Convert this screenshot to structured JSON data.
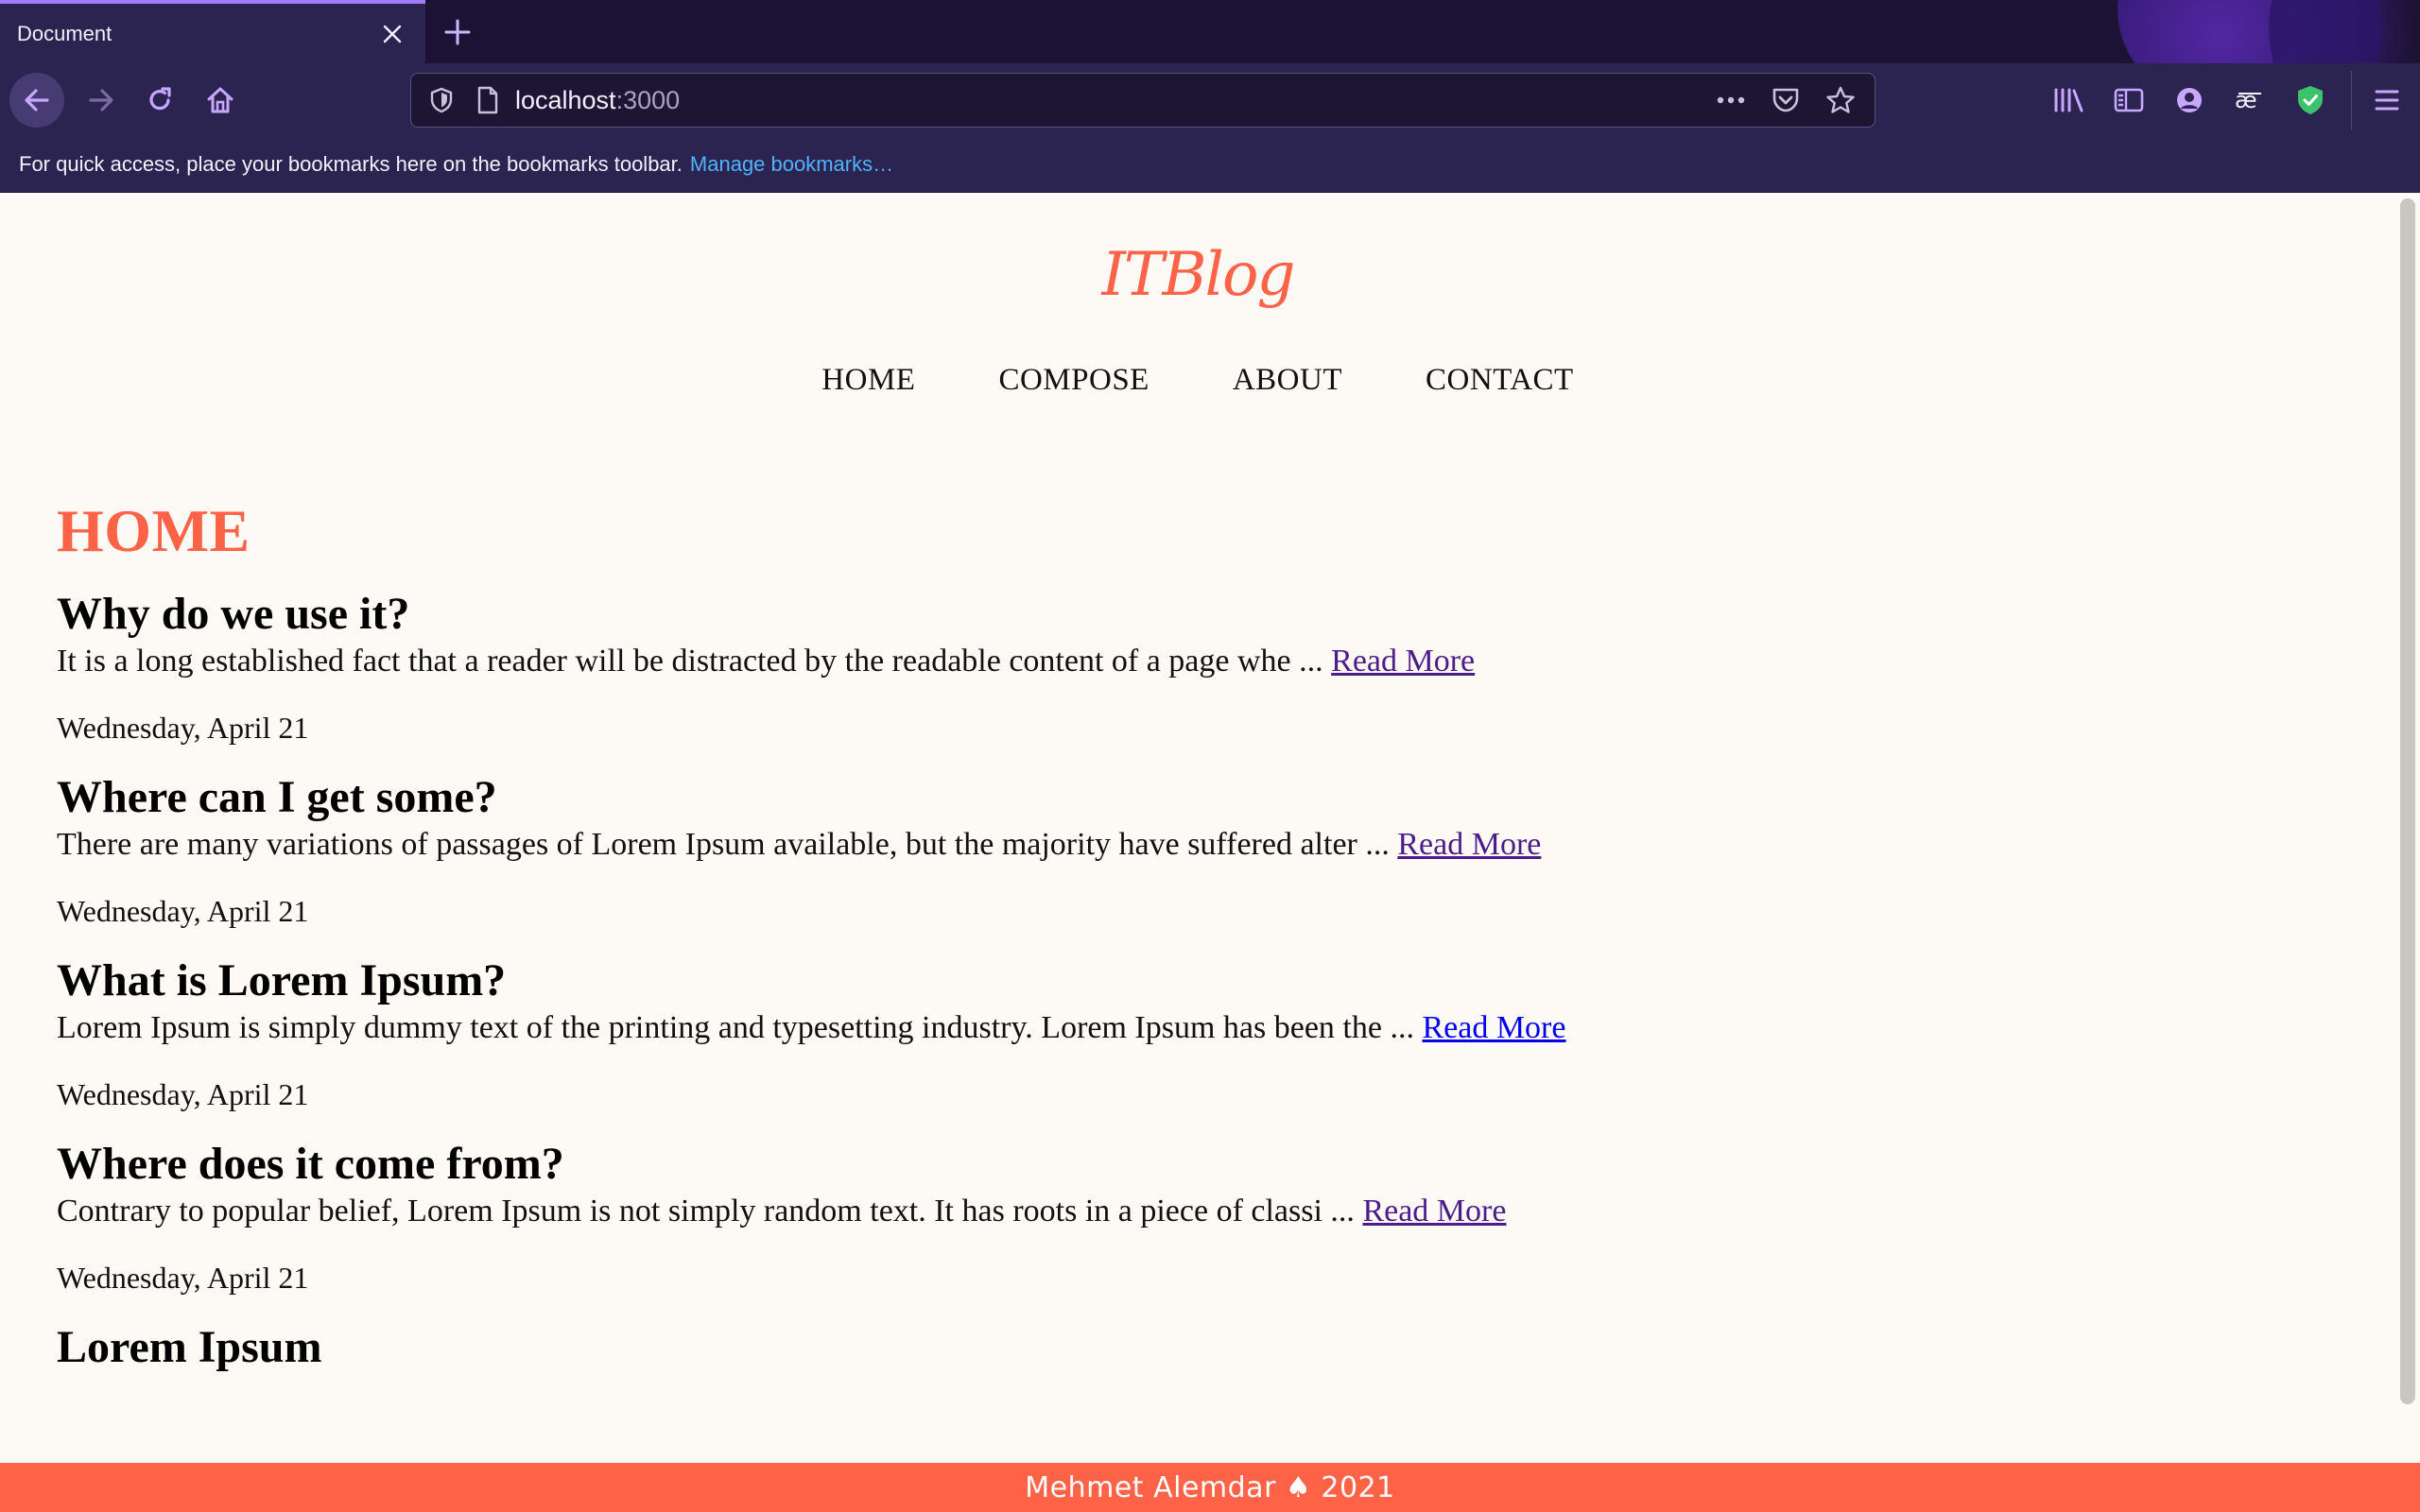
{
  "browser": {
    "tab": {
      "title": "Document"
    },
    "url": {
      "host": "localhost",
      "port": ":3000"
    },
    "bookmarks": {
      "message": "For quick access, place your bookmarks here on the bookmarks toolbar.",
      "manage_link": "Manage bookmarks…"
    },
    "colors": {
      "chrome_bg": "#2b2350",
      "tab_accent": "#a07bff",
      "link_blue": "#4fb3ff"
    }
  },
  "site": {
    "title": "ITBlog",
    "nav": [
      "HOME",
      "COMPOSE",
      "ABOUT",
      "CONTACT"
    ],
    "heading": "HOME",
    "posts": [
      {
        "title": "Why do we use it?",
        "excerpt": "It is a long established fact that a reader will be distracted by the readable content of a page whe ... ",
        "read_more": "Read More",
        "date": "Wednesday, April 21"
      },
      {
        "title": "Where can I get some?",
        "excerpt": "There are many variations of passages of Lorem Ipsum available, but the majority have suffered alter ... ",
        "read_more": "Read More",
        "date": "Wednesday, April 21"
      },
      {
        "title": "What is Lorem Ipsum?",
        "excerpt": "Lorem Ipsum is simply dummy text of the printing and typesetting industry. Lorem Ipsum has been the ... ",
        "read_more": "Read More",
        "date": "Wednesday, April 21"
      },
      {
        "title": "Where does it come from?",
        "excerpt": "Contrary to popular belief, Lorem Ipsum is not simply random text. It has roots in a piece of classi ... ",
        "read_more": "Read More",
        "date": "Wednesday, April 21"
      },
      {
        "title": "Lorem Ipsum"
      }
    ],
    "footer": "Mehmet Alemdar ♠ 2021",
    "colors": {
      "accent": "#ff6347",
      "background": "#fdfaf6",
      "visited_link": "#4b1c8a",
      "link": "#0000ee"
    }
  }
}
